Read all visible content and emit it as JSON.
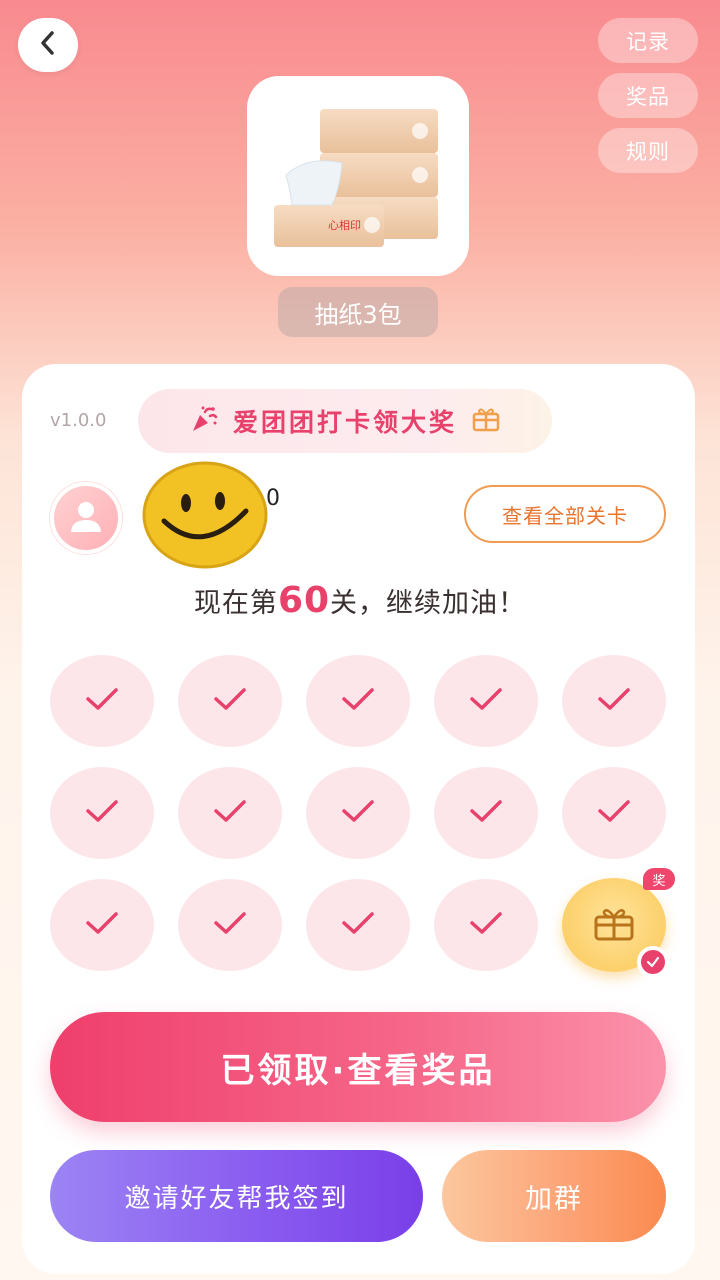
{
  "header": {
    "back_icon": "chevron-left-icon",
    "links": [
      {
        "label": "记录"
      },
      {
        "label": "奖品"
      },
      {
        "label": "规则"
      }
    ]
  },
  "prize": {
    "name": "抽纸3包"
  },
  "event": {
    "version": "v1.0.0",
    "title": "爱团团打卡领大奖",
    "left_icon": "party-popper-icon",
    "right_icon": "gift-icon"
  },
  "user": {
    "name_partial": "0",
    "avatar_icon": "user-icon"
  },
  "view_levels_label": "查看全部关卡",
  "progress": {
    "prefix": "现在第",
    "level": "60",
    "suffix": "关，继续加油！"
  },
  "checkin_grid": {
    "completed_count": 14,
    "gift_badge": "奖",
    "gift_claimed": true
  },
  "buttons": {
    "claimed": "已领取·查看奖品",
    "invite": "邀请好友帮我签到",
    "join_group": "加群"
  },
  "colors": {
    "accent_pink": "#e8416b",
    "orange": "#e8742d",
    "purple": "#8a5cf0"
  }
}
